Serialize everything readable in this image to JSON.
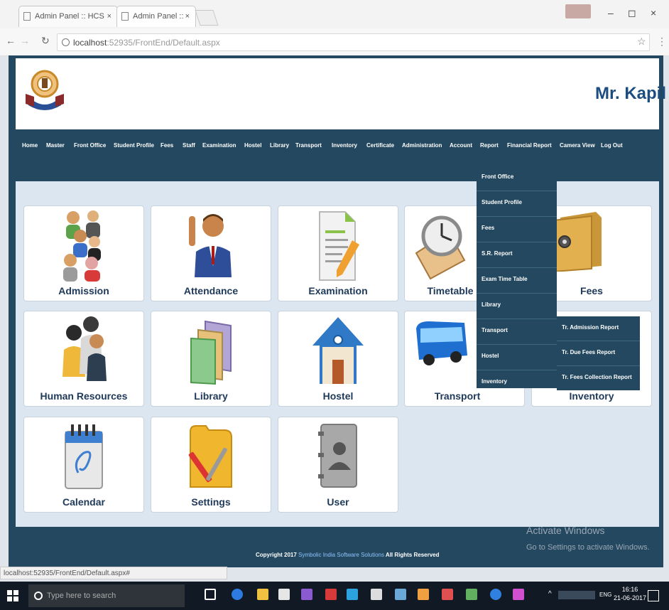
{
  "browser": {
    "tabs": [
      "Admin Panel :: HCS",
      "Admin Panel :: HCS"
    ],
    "url_host": "localhost",
    "url_path": ":52935/FrontEnd/Default.aspx",
    "window_controls": [
      "–",
      "◻",
      "×"
    ]
  },
  "header": {
    "user_name": "Mr. Kapil"
  },
  "menu": [
    "Home",
    "Master",
    "Front Office",
    "Student Profile",
    "Fees",
    "Staff",
    "Examination",
    "Hostel",
    "Library",
    "Transport",
    "Inventory",
    "Certificate",
    "Administration",
    "Account",
    "Report",
    "Financial Report",
    "Camera View",
    "Log Out"
  ],
  "tiles": [
    {
      "label": "Admission",
      "icon": "people-group-icon"
    },
    {
      "label": "Attendance",
      "icon": "raised-hand-person-icon"
    },
    {
      "label": "Examination",
      "icon": "exam-paper-pencil-icon"
    },
    {
      "label": "Timetable",
      "icon": "clock-notebook-icon"
    },
    {
      "label": "Fees",
      "icon": "safe-icon"
    },
    {
      "label": "Human Resources",
      "icon": "staff-group-icon"
    },
    {
      "label": "Library",
      "icon": "books-icon"
    },
    {
      "label": "Hostel",
      "icon": "house-icon"
    },
    {
      "label": "Transport",
      "icon": "bus-icon"
    },
    {
      "label": "Inventory",
      "icon": "inventory-icon"
    },
    {
      "label": "Calendar",
      "icon": "calendar-icon"
    },
    {
      "label": "Settings",
      "icon": "settings-tools-icon"
    },
    {
      "label": "User",
      "icon": "user-address-book-icon"
    }
  ],
  "report_dropdown": [
    "Front Office",
    "Student Profile",
    "Fees",
    "S.R. Report",
    "Exam Time Table",
    "Library",
    "Transport",
    "Hostel",
    "Inventory"
  ],
  "inventory_submenu": [
    "Tr. Admission Report",
    "Tr. Due Fees Report",
    "Tr. Fees Collection Report"
  ],
  "footer": {
    "copyright": "Copyright 2017",
    "company": "Symbolic India Software Solutions",
    "rights": "All Rights Reserved"
  },
  "watermark": {
    "line1": "Activate Windows",
    "line2": "Go to Settings to activate Windows."
  },
  "status_url": "localhost:52935/FrontEnd/Default.aspx#",
  "taskbar": {
    "search_placeholder": "Type here to search",
    "time": "16:16",
    "date": "21-06-2017",
    "lang": "ENG"
  }
}
